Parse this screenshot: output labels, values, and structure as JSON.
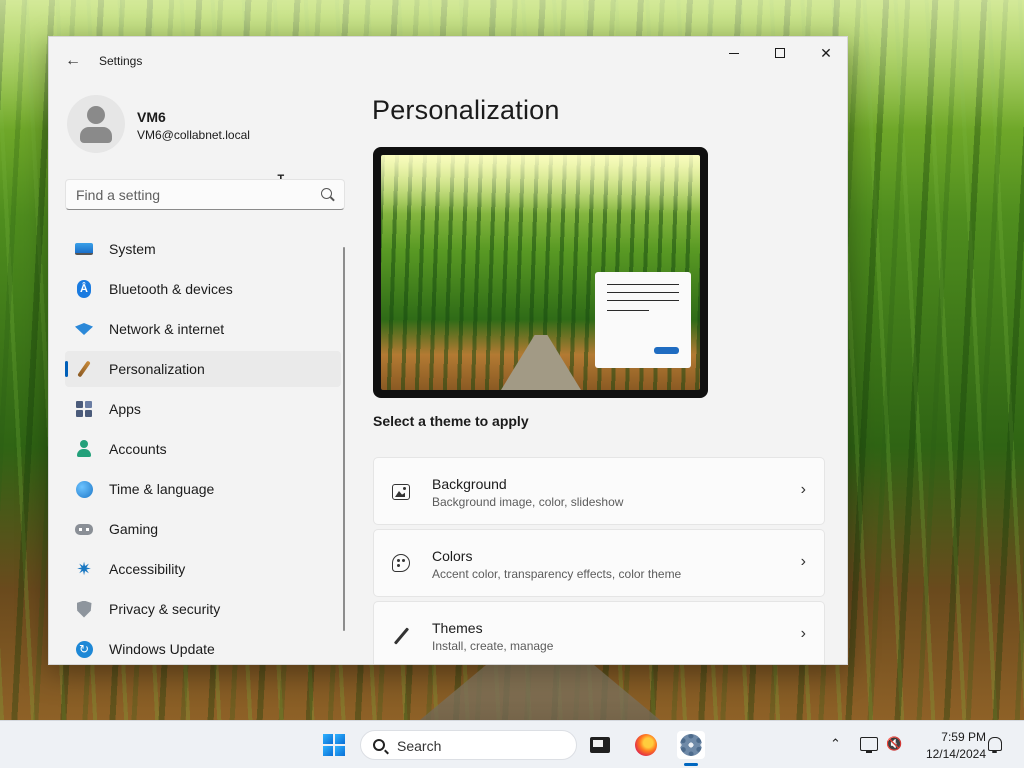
{
  "window": {
    "app_title": "Settings",
    "back_icon": "arrow-left-icon",
    "controls": {
      "minimize_icon": "minimize-icon",
      "maximize_icon": "maximize-icon",
      "close_icon": "close-icon"
    }
  },
  "profile": {
    "name": "VM6",
    "email": "VM6@collabnet.local",
    "avatar_icon": "person-icon"
  },
  "search": {
    "placeholder": "Find a setting",
    "value": "",
    "icon": "search-icon"
  },
  "sidebar": {
    "active_index": 3,
    "accent_color": "#005fb8",
    "items": [
      {
        "label": "System",
        "icon": "monitor-icon"
      },
      {
        "label": "Bluetooth & devices",
        "icon": "bluetooth-icon"
      },
      {
        "label": "Network & internet",
        "icon": "wifi-icon"
      },
      {
        "label": "Personalization",
        "icon": "paintbrush-icon"
      },
      {
        "label": "Apps",
        "icon": "apps-icon"
      },
      {
        "label": "Accounts",
        "icon": "person-icon"
      },
      {
        "label": "Time & language",
        "icon": "globe-clock-icon"
      },
      {
        "label": "Gaming",
        "icon": "gamepad-icon"
      },
      {
        "label": "Accessibility",
        "icon": "accessibility-icon"
      },
      {
        "label": "Privacy & security",
        "icon": "shield-icon"
      },
      {
        "label": "Windows Update",
        "icon": "update-icon"
      }
    ]
  },
  "main": {
    "page_title": "Personalization",
    "theme_prompt": "Select a theme to apply",
    "cards": [
      {
        "title": "Background",
        "subtitle": "Background image, color, slideshow",
        "icon": "image-icon"
      },
      {
        "title": "Colors",
        "subtitle": "Accent color, transparency effects, color theme",
        "icon": "palette-icon"
      },
      {
        "title": "Themes",
        "subtitle": "Install, create, manage",
        "icon": "pen-icon"
      }
    ]
  },
  "taskbar": {
    "search_label": "Search",
    "apps": [
      {
        "name": "start",
        "icon": "windows-logo-icon"
      },
      {
        "name": "task-view",
        "icon": "task-view-icon"
      },
      {
        "name": "firefox",
        "icon": "firefox-icon"
      },
      {
        "name": "settings",
        "icon": "gear-icon",
        "active": true
      }
    ],
    "tray": {
      "time": "7:59 PM",
      "date": "12/14/2024",
      "icons": [
        "chevron-up-icon",
        "network-icon",
        "volume-muted-icon",
        "bell-icon"
      ]
    }
  }
}
